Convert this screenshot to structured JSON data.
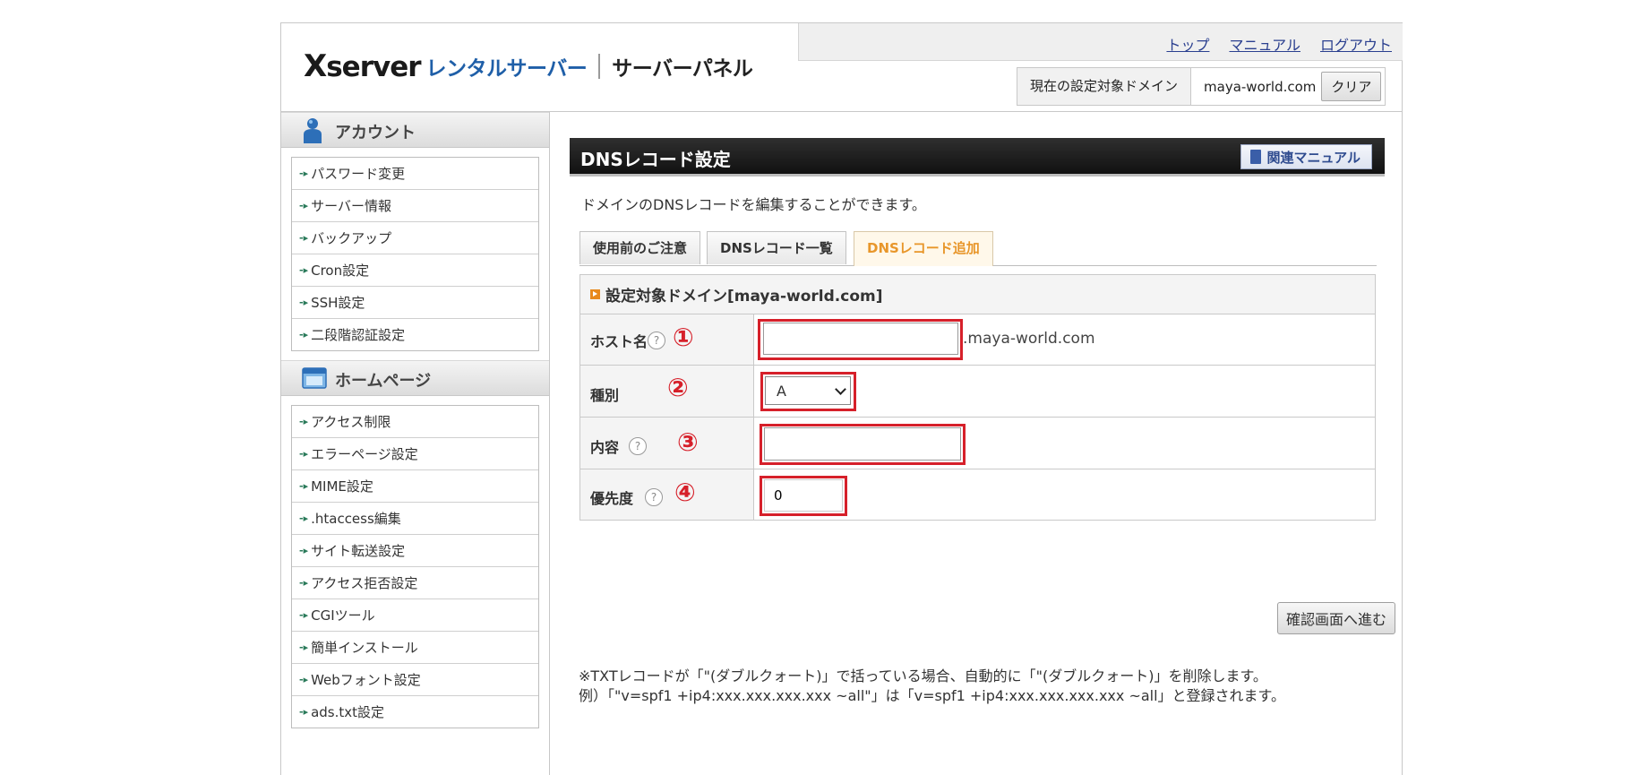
{
  "header": {
    "brand_x": "X",
    "brand_rest": "server",
    "rental": "レンタルサーバー",
    "panel": "サーバーパネル",
    "nav": [
      "トップ",
      "マニュアル",
      "ログアウト"
    ],
    "domain_label": "現在の設定対象ドメイン",
    "domain_value": "maya-world.com",
    "clear_label": "クリア"
  },
  "sidebar": {
    "account": {
      "title": "アカウント",
      "items": [
        "パスワード変更",
        "サーバー情報",
        "バックアップ",
        "Cron設定",
        "SSH設定",
        "二段階認証設定"
      ]
    },
    "homepage": {
      "title": "ホームページ",
      "items": [
        "アクセス制限",
        "エラーページ設定",
        "MIME設定",
        ".htaccess編集",
        "サイト転送設定",
        "アクセス拒否設定",
        "CGIツール",
        "簡単インストール",
        "Webフォント設定",
        "ads.txt設定"
      ]
    }
  },
  "main": {
    "title": "DNSレコード設定",
    "manual_label": "関連マニュアル",
    "description": "ドメインのDNSレコードを編集することができます。",
    "tabs": [
      "使用前のご注意",
      "DNSレコード一覧",
      "DNSレコード追加"
    ],
    "active_tab": 2,
    "form": {
      "heading": "設定対象ドメイン[maya-world.com]",
      "rows": {
        "host": {
          "label": "ホスト名",
          "number": "①",
          "value": "",
          "suffix": ".maya-world.com"
        },
        "type": {
          "label": "種別",
          "number": "②",
          "value": "A"
        },
        "content": {
          "label": "内容",
          "number": "③",
          "value": ""
        },
        "priority": {
          "label": "優先度",
          "number": "④",
          "value": "0"
        }
      },
      "help_glyph": "?"
    },
    "confirm_label": "確認画面へ進む",
    "note_line1": "※TXTレコードが「\"(ダブルクォート)」で括っている場合、自動的に「\"(ダブルクォート)」を削除します。",
    "note_line2": "例）「\"v=spf1 +ip4:xxx.xxx.xxx.xxx ~all\"」は「v=spf1 +ip4:xxx.xxx.xxx.xxx ~all」と登録されます。"
  },
  "colors": {
    "highlight": "#d6202a",
    "brand_blue": "#1f5fa8",
    "active_tab": "#e8962a",
    "link": "#2a3f8f"
  }
}
